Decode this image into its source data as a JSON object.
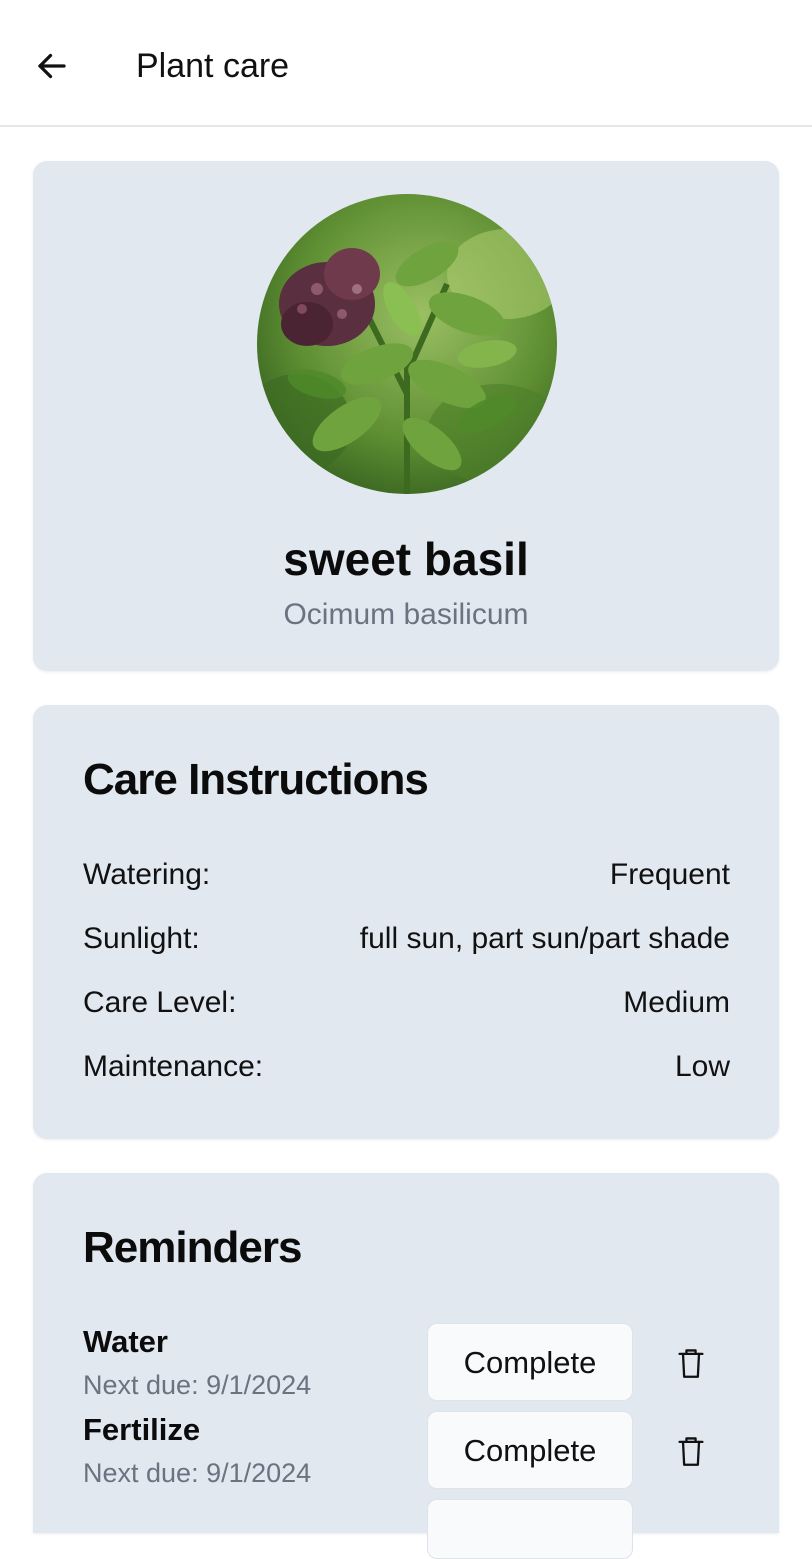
{
  "header": {
    "title": "Plant care",
    "back_icon": "arrow-left-icon"
  },
  "plant": {
    "name": "sweet basil",
    "scientific_name": "Ocimum basilicum"
  },
  "care": {
    "title": "Care Instructions",
    "rows": [
      {
        "label": "Watering:",
        "value": "Frequent"
      },
      {
        "label": "Sunlight:",
        "value": "full sun, part sun/part shade"
      },
      {
        "label": "Care Level:",
        "value": "Medium"
      },
      {
        "label": "Maintenance:",
        "value": "Low"
      }
    ]
  },
  "reminders": {
    "title": "Reminders",
    "items": [
      {
        "name": "Water",
        "due": "Next due: 9/1/2024",
        "button": "Complete",
        "delete_icon": "trash-icon"
      },
      {
        "name": "Fertilize",
        "due": "Next due: 9/1/2024",
        "button": "Complete",
        "delete_icon": "trash-icon"
      }
    ]
  },
  "colors": {
    "card_bg": "#e2e8f0",
    "muted_text": "#6b7280",
    "button_bg": "#f8fafc"
  }
}
